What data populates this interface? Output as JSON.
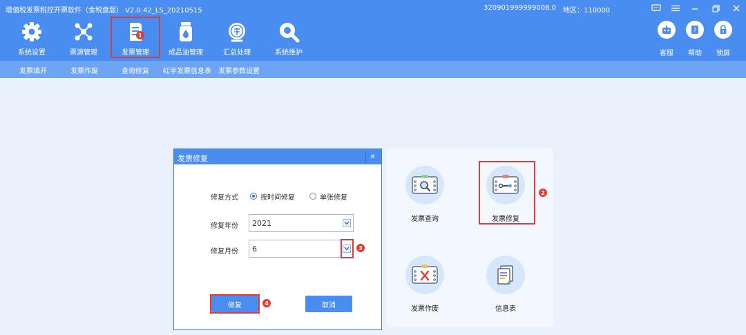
{
  "titlebar": {
    "app_title": "增值税发票税控开票软件（金税盘版） V2.0.42_LS_20210515",
    "tax_no": "320901999999008.0",
    "region": "地区：110000"
  },
  "main_tabs": [
    {
      "label": "系统设置",
      "icon": "gear-icon"
    },
    {
      "label": "票源管理",
      "icon": "network-icon"
    },
    {
      "label": "发票管理",
      "icon": "invoice-icon"
    },
    {
      "label": "成品油管理",
      "icon": "oil-icon"
    },
    {
      "label": "汇总处理",
      "icon": "tax-summary-icon"
    },
    {
      "label": "系统维护",
      "icon": "wrench-icon"
    }
  ],
  "right_tools": [
    {
      "label": "客服",
      "icon": "robot-icon"
    },
    {
      "label": "帮助",
      "icon": "help-icon"
    },
    {
      "label": "锁屏",
      "icon": "lock-icon"
    }
  ],
  "submenu": [
    "发票填开",
    "发票作废",
    "查询修复",
    "红字发票信息表",
    "发票参数设置"
  ],
  "dialog": {
    "title": "发票修复",
    "close_symbol": "✕",
    "mode_label": "修复方式",
    "mode_options": [
      {
        "label": "按时间修复",
        "checked": true
      },
      {
        "label": "单张修复",
        "checked": false
      }
    ],
    "year_label": "修复年份",
    "year_value": "2021",
    "month_label": "修复月份",
    "month_value": "6",
    "repair_button": "修复",
    "cancel_button": "取消"
  },
  "panel": {
    "items": [
      {
        "label": "发票查询",
        "icon": "invoice-search-icon"
      },
      {
        "label": "发票修复",
        "icon": "invoice-repair-icon"
      },
      {
        "label": "发票作废",
        "icon": "invoice-void-icon"
      },
      {
        "label": "信息表",
        "icon": "info-sheet-icon"
      }
    ]
  },
  "markers": [
    "1",
    "2",
    "3",
    "4"
  ],
  "colors": {
    "header": "#4a8df0",
    "submenu": "#6ea4f4",
    "background": "#e9f1fd",
    "marker": "#e53935"
  }
}
